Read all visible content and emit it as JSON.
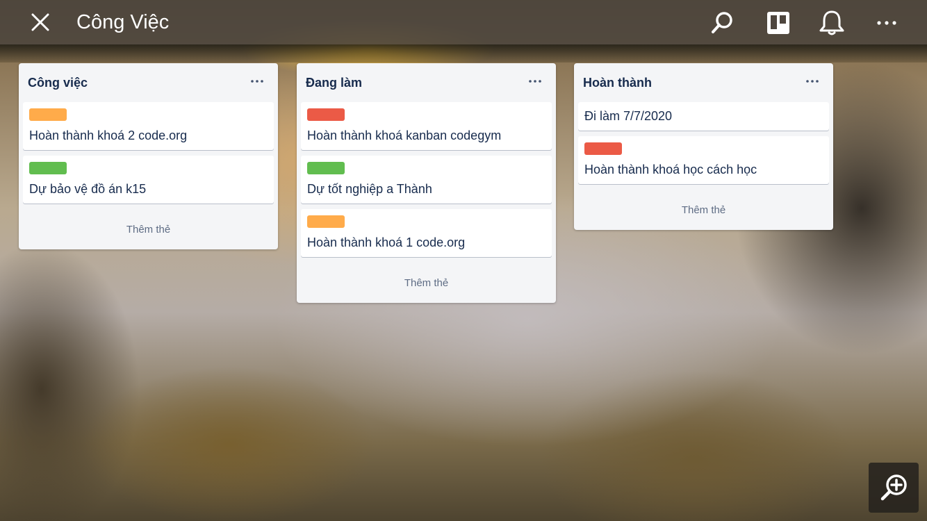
{
  "header": {
    "title": "Công Việc",
    "icons": [
      "close-icon",
      "search-icon",
      "board-view-icon",
      "bell-icon",
      "more-icon"
    ]
  },
  "colors": {
    "orange": "#ffab4a",
    "red": "#eb5a46",
    "green": "#61bd4f"
  },
  "lists": [
    {
      "title": "Công việc",
      "cards": [
        {
          "label_color": "orange",
          "text": "Hoàn thành khoá 2 code.org"
        },
        {
          "label_color": "green",
          "text": "Dự bảo vệ đồ án k15"
        }
      ],
      "add_label": "Thêm thẻ"
    },
    {
      "title": "Đang làm",
      "cards": [
        {
          "label_color": "red",
          "text": "Hoàn thành khoá kanban codegym"
        },
        {
          "label_color": "green",
          "text": "Dự tốt nghiệp a Thành"
        },
        {
          "label_color": "orange",
          "text": "Hoàn thành khoá 1 code.org"
        }
      ],
      "add_label": "Thêm thẻ"
    },
    {
      "title": "Hoàn thành",
      "cards": [
        {
          "label_color": null,
          "text": "Đi làm 7/7/2020"
        },
        {
          "label_color": "red",
          "text": "Hoàn thành khoá học cách học"
        }
      ],
      "add_label": "Thêm thẻ"
    }
  ]
}
